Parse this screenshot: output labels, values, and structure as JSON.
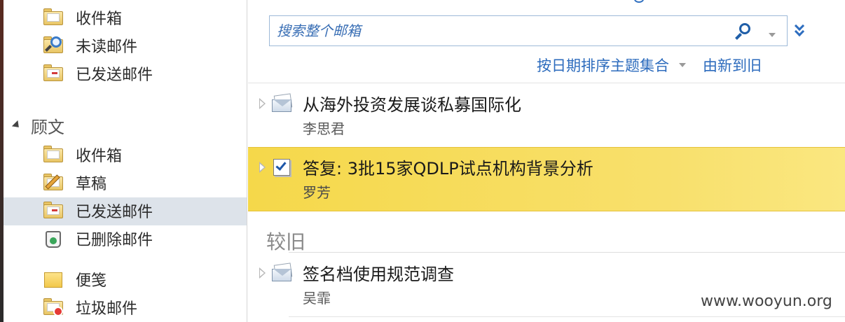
{
  "folders": {
    "top": [
      {
        "label": "收件箱",
        "icon": "inbox-folder-icon"
      },
      {
        "label": "未读邮件",
        "icon": "search-folder-icon"
      },
      {
        "label": "已发送邮件",
        "icon": "sent-folder-icon"
      }
    ],
    "group": {
      "label": "顾文",
      "items": [
        {
          "label": "收件箱",
          "icon": "inbox-folder-icon"
        },
        {
          "label": "草稿",
          "icon": "drafts-folder-icon"
        },
        {
          "label": "已发送邮件",
          "icon": "sent-folder-icon",
          "selected": true
        },
        {
          "label": "已删除邮件",
          "icon": "recycle-bin-icon"
        },
        {
          "label": "便笺",
          "icon": "notes-icon"
        },
        {
          "label": "垃圾邮件",
          "icon": "junk-folder-icon"
        }
      ]
    }
  },
  "search": {
    "placeholder": "搜索整个邮箱"
  },
  "sort": {
    "arrange_label": "按日期排序主题集合",
    "order_label": "由新到旧"
  },
  "mail_list": {
    "items": [
      {
        "subject": "从海外投资发展谈私募国际化",
        "sender": "李思君",
        "icon": "envelope-open-icon"
      },
      {
        "subject": "答复: 3批15家QDLP试点机构背景分析",
        "sender": "罗芳",
        "icon": "task-check-icon",
        "highlighted": true
      }
    ],
    "older_section_label": "较旧",
    "older_items": [
      {
        "subject": "签名档使用规范调查",
        "sender": "吴霏",
        "icon": "envelope-open-icon"
      }
    ]
  },
  "watermark": "www.wooyun.org",
  "colors": {
    "accent": "#2c6bbd",
    "highlight": "#f5d84a",
    "selection": "#dde3ea"
  }
}
